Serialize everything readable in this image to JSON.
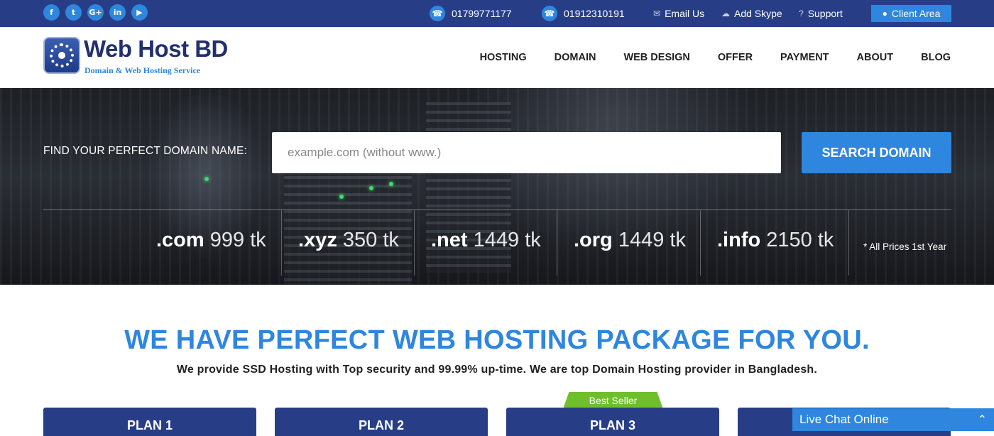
{
  "topbar": {
    "social": [
      {
        "icon": "facebook-icon",
        "glyph": "f"
      },
      {
        "icon": "twitter-icon",
        "glyph": "t"
      },
      {
        "icon": "google-plus-icon",
        "glyph": "G+"
      },
      {
        "icon": "linkedin-icon",
        "glyph": "in"
      },
      {
        "icon": "youtube-icon",
        "glyph": "▶"
      }
    ],
    "phone1": "01799771177",
    "phone2": "01912310191",
    "email_label": "Email Us",
    "skype_label": "Add Skype",
    "support_label": "Support",
    "client_area_label": "Client Area"
  },
  "header": {
    "logo_title": "Web Host BD",
    "logo_subtitle": "Domain & Web Hosting Service",
    "nav": [
      "HOSTING",
      "DOMAIN",
      "WEB DESIGN",
      "OFFER",
      "PAYMENT",
      "ABOUT",
      "BLOG"
    ]
  },
  "hero": {
    "find_label": "FIND YOUR PERFECT DOMAIN NAME:",
    "search_placeholder": "example.com (without www.)",
    "search_button": "SEARCH DOMAIN",
    "prices": [
      {
        "ext": ".com",
        "amount": "999 tk"
      },
      {
        "ext": ".xyz",
        "amount": "350 tk"
      },
      {
        "ext": ".net",
        "amount": "1449 tk"
      },
      {
        "ext": ".org",
        "amount": "1449 tk"
      },
      {
        "ext": ".info",
        "amount": "2150 tk"
      }
    ],
    "note": "* All Prices 1st Year"
  },
  "main": {
    "headline": "WE HAVE PERFECT WEB HOSTING PACKAGE FOR YOU.",
    "subline": "We provide SSD Hosting with Top security and 99.99% up-time. We are top Domain Hosting provider in Bangladesh.",
    "plans": [
      "PLAN 1",
      "PLAN 2",
      "PLAN 3",
      ""
    ],
    "best_seller": "Best Seller"
  },
  "chat": {
    "label": "Live Chat Online"
  },
  "colors": {
    "navy": "#273e87",
    "accent_blue": "#2e86de",
    "best_seller_green": "#6fbf2a"
  }
}
